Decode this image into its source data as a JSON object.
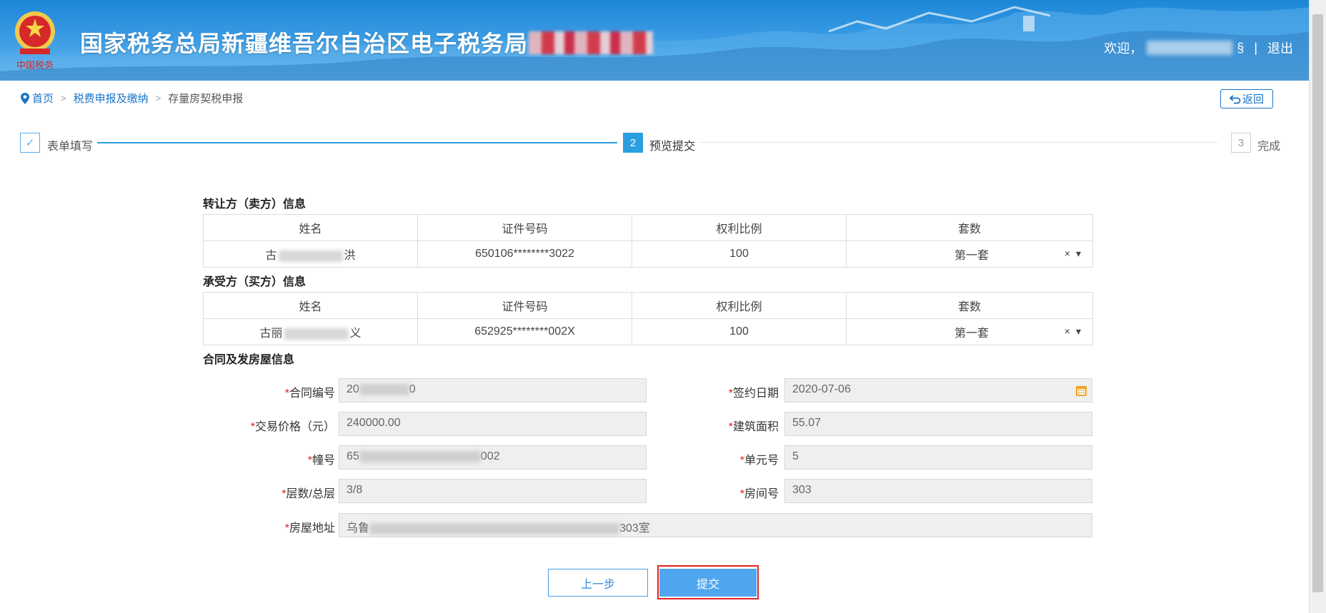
{
  "header": {
    "title": "国家税务总局新疆维吾尔自治区电子税务局",
    "welcome": "欢迎，",
    "user_suffix": "§",
    "separator": "|",
    "logout": "退出"
  },
  "breadcrumb": {
    "home": "首页",
    "sep": ">",
    "level1": "税费申报及缴纳",
    "current": "存量房契税申报"
  },
  "back_button": "返回",
  "steps": [
    {
      "number": "✓",
      "label": "表单填写"
    },
    {
      "number": "2",
      "label": "预览提交"
    },
    {
      "number": "3",
      "label": "完成"
    }
  ],
  "seller": {
    "title": "转让方（卖方）信息",
    "headers": [
      "姓名",
      "证件号码",
      "权利比例",
      "套数"
    ],
    "row": {
      "name_start": "古",
      "name_end": "洪",
      "id": "650106********3022",
      "ratio": "100",
      "sets": "第一套"
    }
  },
  "buyer": {
    "title": "承受方（买方）信息",
    "headers": [
      "姓名",
      "证件号码",
      "权利比例",
      "套数"
    ],
    "row": {
      "name_start": "古丽",
      "name_end": "义",
      "id": "652925********002X",
      "ratio": "100",
      "sets": "第一套"
    }
  },
  "select_clear": "×",
  "select_arrow": "▾",
  "contract": {
    "title": "合同及发房屋信息",
    "required_mark": "*",
    "fields": {
      "contract_no": {
        "label": "合同编号",
        "value_start": "20",
        "value_end": "0"
      },
      "sign_date": {
        "label": "签约日期",
        "value": "2020-07-06"
      },
      "price": {
        "label": "交易价格（元）",
        "value": "240000.00"
      },
      "area": {
        "label": "建筑面积",
        "value": "55.07"
      },
      "building": {
        "label": "幢号",
        "value_start": "65",
        "value_end": "002"
      },
      "unit": {
        "label": "单元号",
        "value": "5"
      },
      "floors": {
        "label": "层数/总层",
        "value": "3/8"
      },
      "room": {
        "label": "房间号",
        "value": "303"
      },
      "address": {
        "label": "房屋地址",
        "value_start": "乌鲁",
        "value_end": "303室"
      }
    }
  },
  "buttons": {
    "prev": "上一步",
    "submit": "提交"
  },
  "colors": {
    "primary": "#1a73c8",
    "step_active": "#2a9fe0",
    "submit_bg": "#4fa6ee",
    "highlight_border": "#e02323",
    "required": "#e02020"
  }
}
